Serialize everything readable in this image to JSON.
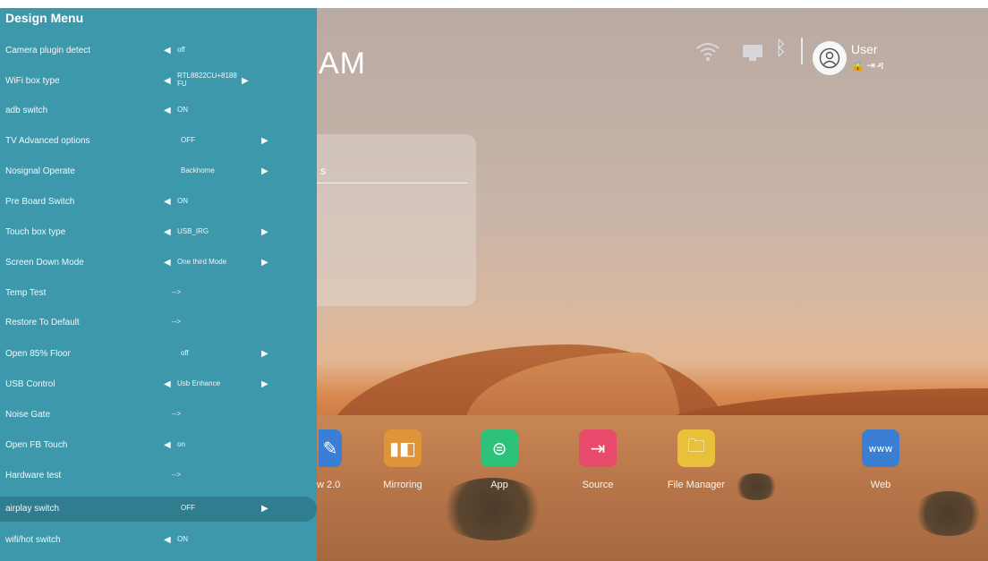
{
  "menu": {
    "title": "Design Menu",
    "items": [
      {
        "label": "Camera plugin detect",
        "value": "off",
        "left_arrow": true,
        "right_arrow": false
      },
      {
        "label": "WiFi box type",
        "value": "RTL8822CU+8188 FU",
        "left_arrow": true,
        "right_arrow": true
      },
      {
        "label": "adb switch",
        "value": "ON",
        "left_arrow": true,
        "right_arrow": false
      },
      {
        "label": "TV Advanced options",
        "value": "OFF",
        "left_arrow": false,
        "right_arrow": true
      },
      {
        "label": "Nosignal Operate",
        "value": "Backhome",
        "left_arrow": false,
        "right_arrow": true
      },
      {
        "label": "Pre Board Switch",
        "value": "ON",
        "left_arrow": true,
        "right_arrow": false
      },
      {
        "label": "Touch box type",
        "value": "USB_IRG",
        "left_arrow": true,
        "right_arrow": true
      },
      {
        "label": "Screen Down Mode",
        "value": "One third Mode",
        "left_arrow": true,
        "right_arrow": true
      },
      {
        "label": "Temp Test",
        "value": "-->",
        "left_arrow": false,
        "right_arrow": false
      },
      {
        "label": "Restore To Default",
        "value": "-->",
        "left_arrow": false,
        "right_arrow": false
      },
      {
        "label": "Open 85% Floor",
        "value": "off",
        "left_arrow": false,
        "right_arrow": true
      },
      {
        "label": "USB Control",
        "value": "Usb Enhance",
        "left_arrow": true,
        "right_arrow": true
      },
      {
        "label": "Noise Gate",
        "value": "-->",
        "left_arrow": false,
        "right_arrow": false
      },
      {
        "label": "Open FB Touch",
        "value": "on",
        "left_arrow": true,
        "right_arrow": false
      },
      {
        "label": "Hardware test",
        "value": "-->",
        "left_arrow": false,
        "right_arrow": false
      },
      {
        "label": "airplay switch",
        "value": "OFF",
        "left_arrow": false,
        "right_arrow": true,
        "selected": true
      },
      {
        "label": "wifi/hot switch",
        "value": "ON",
        "left_arrow": true,
        "right_arrow": false
      }
    ]
  },
  "launcher": {
    "title_fragment": "AM",
    "panel_fragment": "s",
    "user": {
      "name": "User",
      "icons": "🔒⇥ዳ"
    },
    "dock": [
      {
        "label": "w 2.0",
        "icon": "pen-icon",
        "color": "#3b7fd4"
      },
      {
        "label": "Mirroring",
        "icon": "mirroring-icon",
        "color": "#e0943a"
      },
      {
        "label": "App",
        "icon": "app-icon",
        "color": "#2ec17a"
      },
      {
        "label": "Source",
        "icon": "source-icon",
        "color": "#e84a6c"
      },
      {
        "label": "File Manager",
        "icon": "folder-icon",
        "color": "#e8c03a"
      },
      {
        "label": "Web",
        "icon": "web-icon",
        "color": "#3a7fd4"
      }
    ]
  }
}
